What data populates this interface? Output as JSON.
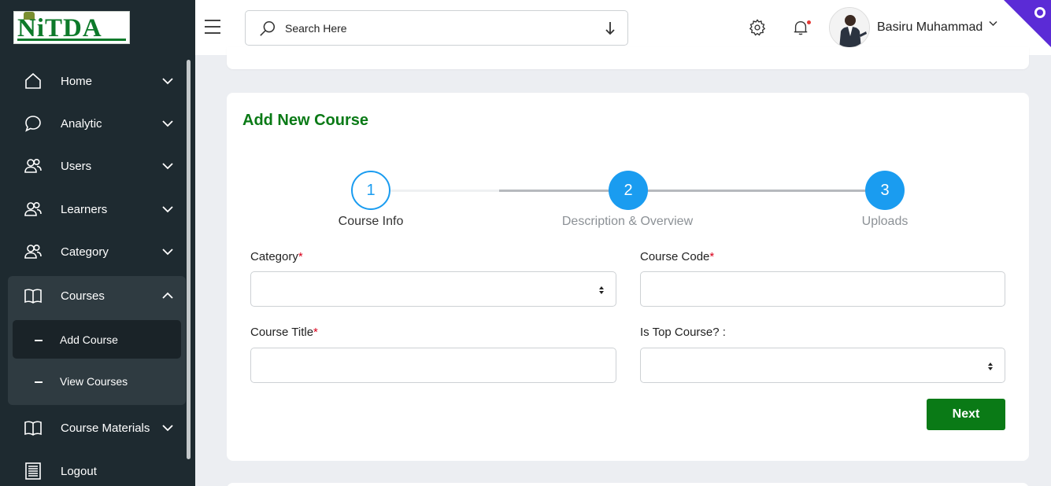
{
  "logo": {
    "text": "NiTDA"
  },
  "sidebar": {
    "items": [
      {
        "label": "Home",
        "icon": "home-icon"
      },
      {
        "label": "Analytic",
        "icon": "chat-bubble-icon"
      },
      {
        "label": "Users",
        "icon": "users-icon"
      },
      {
        "label": "Learners",
        "icon": "users-icon"
      },
      {
        "label": "Category",
        "icon": "users-icon"
      },
      {
        "label": "Courses",
        "icon": "book-icon"
      },
      {
        "label": "Course Materials",
        "icon": "book-icon"
      },
      {
        "label": "Logout",
        "icon": "document-icon"
      }
    ],
    "courses_sub": [
      {
        "label": "Add Course"
      },
      {
        "label": "View Courses"
      }
    ]
  },
  "header": {
    "search_placeholder": "Search Here",
    "username": "Basiru Muhammad"
  },
  "form": {
    "title": "Add New Course",
    "steps": [
      {
        "number": "1",
        "label": "Course Info"
      },
      {
        "number": "2",
        "label": "Description & Overview"
      },
      {
        "number": "3",
        "label": "Uploads"
      }
    ],
    "fields": {
      "category": "Category",
      "course_code": "Course Code",
      "course_title": "Course Title",
      "is_top_course": "Is Top Course? :"
    },
    "required_mark": "*",
    "next_label": "Next"
  },
  "colors": {
    "sidebar_bg": "#1e2a30",
    "accent_green": "#0a7a16",
    "step_blue": "#1a9cf0",
    "corner_purple": "#5b2bd6"
  }
}
